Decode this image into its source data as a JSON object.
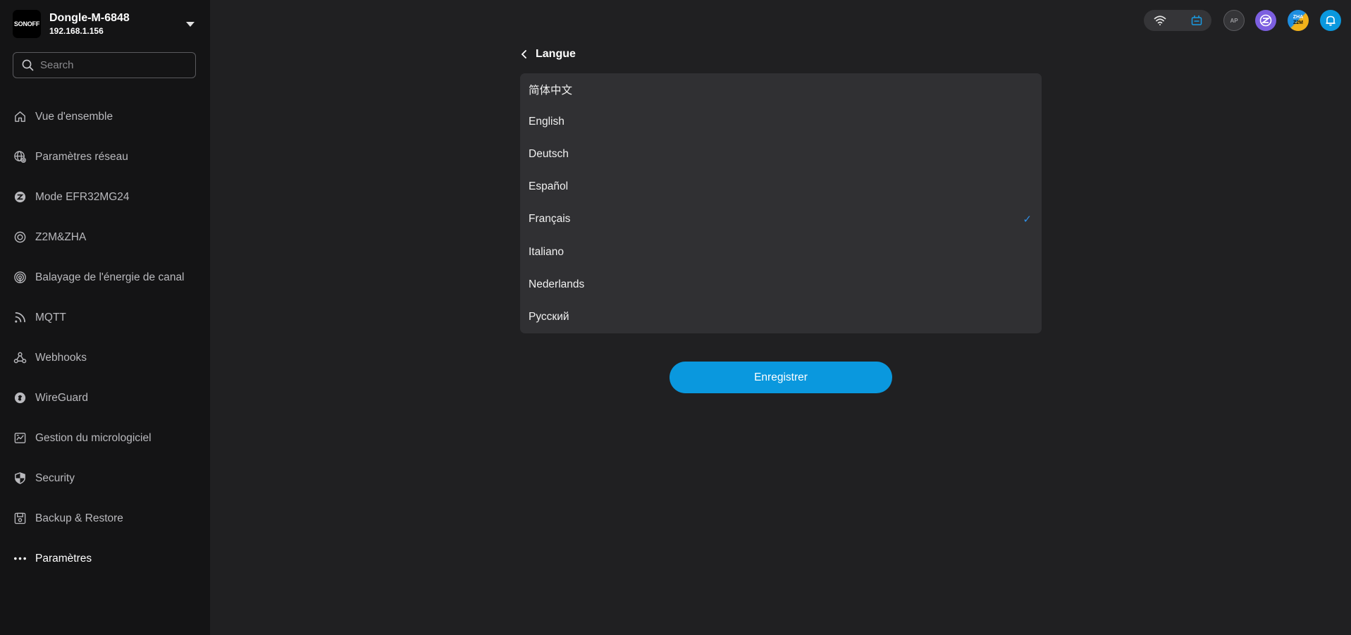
{
  "device": {
    "logo_text": "SONOFF",
    "name": "Dongle-M-6848",
    "ip": "192.168.1.156"
  },
  "search": {
    "placeholder": "Search"
  },
  "sidebar": {
    "items": [
      {
        "label": "Vue d'ensemble",
        "icon": "home-icon"
      },
      {
        "label": "Paramètres réseau",
        "icon": "network-globe-icon"
      },
      {
        "label": "Mode EFR32MG24",
        "icon": "zigbee-mode-icon"
      },
      {
        "label": "Z2M&ZHA",
        "icon": "z2m-zha-icon"
      },
      {
        "label": "Balayage de l'énergie de canal",
        "icon": "antenna-scan-icon"
      },
      {
        "label": "MQTT",
        "icon": "rss-icon"
      },
      {
        "label": "Webhooks",
        "icon": "webhooks-icon"
      },
      {
        "label": "WireGuard",
        "icon": "wireguard-icon"
      },
      {
        "label": "Gestion du micrologiciel",
        "icon": "firmware-icon"
      },
      {
        "label": "Security",
        "icon": "shield-icon"
      },
      {
        "label": "Backup & Restore",
        "icon": "backup-icon"
      },
      {
        "label": "Paramètres",
        "icon": "more-dots-icon",
        "active": true
      }
    ]
  },
  "topbar": {
    "icons": [
      "wifi-icon",
      "device-status-icon",
      "ap-icon",
      "zigbee-icon",
      "zha-z2m-icon",
      "bell-icon"
    ],
    "ap_label": "AP",
    "zha_label": "ZHA",
    "z2m_label": "Z2M"
  },
  "page": {
    "title": "Langue",
    "languages": [
      {
        "label": "简体中文",
        "selected": false
      },
      {
        "label": "English",
        "selected": false
      },
      {
        "label": "Deutsch",
        "selected": false
      },
      {
        "label": "Español",
        "selected": false
      },
      {
        "label": "Français",
        "selected": true,
        "check": "✓"
      },
      {
        "label": "Italiano",
        "selected": false
      },
      {
        "label": "Nederlands",
        "selected": false
      },
      {
        "label": "Русский",
        "selected": false
      }
    ],
    "save_label": "Enregistrer"
  },
  "colors": {
    "accent": "#0a98de",
    "check": "#2f8fe8",
    "sidebar_bg": "#141415",
    "main_bg": "#202022",
    "list_bg": "#303033"
  }
}
